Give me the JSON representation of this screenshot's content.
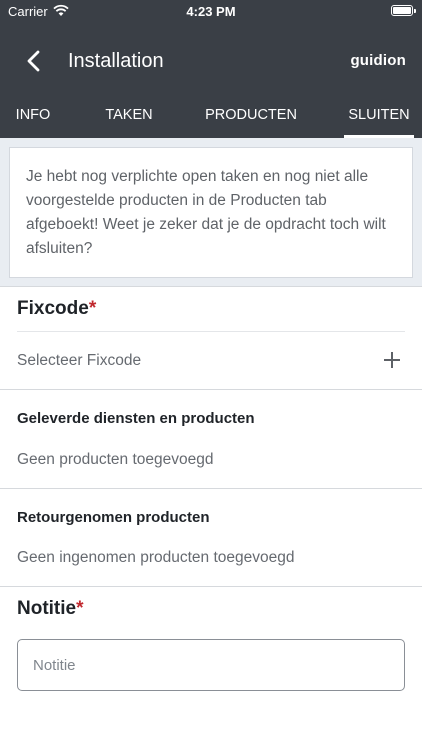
{
  "status_bar": {
    "carrier": "Carrier",
    "time": "4:23 PM"
  },
  "nav": {
    "title": "Installation",
    "logo": "guidion"
  },
  "tabs": [
    {
      "label": "INFO",
      "active": false
    },
    {
      "label": "TAKEN",
      "active": false
    },
    {
      "label": "PRODUCTEN",
      "active": false
    },
    {
      "label": "SLUITEN",
      "active": true
    }
  ],
  "warning": {
    "text": "Je hebt nog verplichte open taken en nog niet alle voorgestelde producten in de Producten tab afgeboekt! Weet je zeker dat je de opdracht toch wilt afsluiten?"
  },
  "fixcode": {
    "title": "Fixcode",
    "required_mark": "*",
    "select_label": "Selecteer Fixcode"
  },
  "delivered": {
    "title": "Geleverde diensten en producten",
    "empty_text": "Geen producten toegevoegd"
  },
  "returned": {
    "title": "Retourgenomen producten",
    "empty_text": "Geen ingenomen producten toegevoegd"
  },
  "note": {
    "title": "Notitie",
    "required_mark": "*",
    "placeholder": "Notitie",
    "value": ""
  },
  "colors": {
    "header_bg": "#3a3f46",
    "required": "#c0282e",
    "warning_bg": "#e9edf2"
  }
}
